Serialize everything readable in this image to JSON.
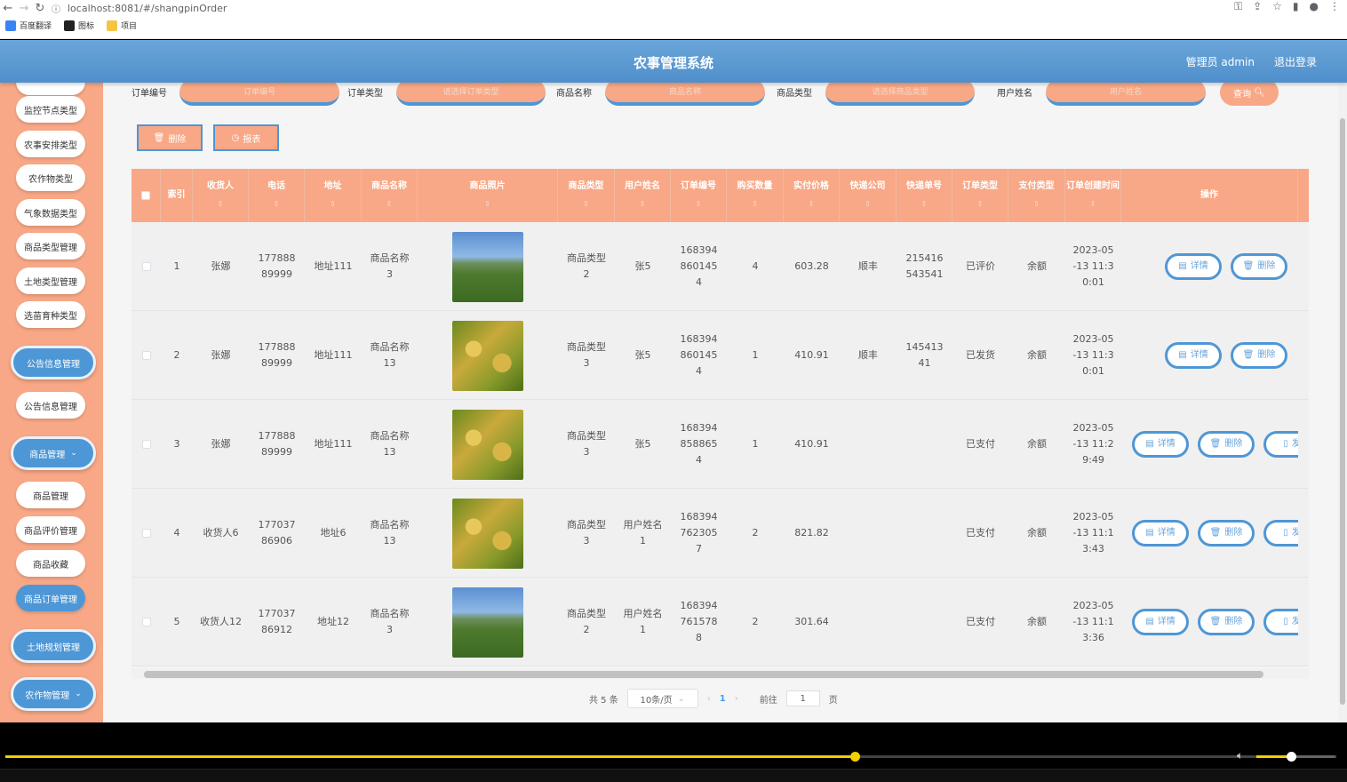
{
  "browser": {
    "url": "localhost:8081/#/shangpinOrder",
    "bookmarks": [
      "百度翻译",
      "图标",
      "项目"
    ]
  },
  "header": {
    "title": "农事管理系统",
    "admin": "管理员 admin",
    "logout": "退出登录"
  },
  "sidebar": {
    "items": [
      {
        "label": "监控节点类型",
        "type": "sub"
      },
      {
        "label": "农事安排类型",
        "type": "sub"
      },
      {
        "label": "农作物类型",
        "type": "sub"
      },
      {
        "label": "气象数据类型",
        "type": "sub"
      },
      {
        "label": "商品类型管理",
        "type": "sub"
      },
      {
        "label": "土地类型管理",
        "type": "sub"
      },
      {
        "label": "选苗育种类型",
        "type": "sub"
      },
      {
        "label": "公告信息管理",
        "type": "group"
      },
      {
        "label": "公告信息管理",
        "type": "sub"
      },
      {
        "label": "商品管理",
        "type": "group"
      },
      {
        "label": "商品管理",
        "type": "sub"
      },
      {
        "label": "商品评价管理",
        "type": "sub"
      },
      {
        "label": "商品收藏",
        "type": "sub"
      },
      {
        "label": "商品订单管理",
        "type": "active"
      },
      {
        "label": "土地规划管理",
        "type": "group"
      },
      {
        "label": "农作物管理",
        "type": "group"
      }
    ]
  },
  "search": {
    "fields": [
      {
        "label": "订单编号",
        "placeholder": "订单编号"
      },
      {
        "label": "订单类型",
        "placeholder": "请选择订单类型"
      },
      {
        "label": "商品名称",
        "placeholder": "商品名称"
      },
      {
        "label": "商品类型",
        "placeholder": "请选择商品类型"
      },
      {
        "label": "用户姓名",
        "placeholder": "用户姓名"
      }
    ],
    "button": "查询"
  },
  "toolbar": {
    "delete": "删除",
    "report": "报表"
  },
  "table": {
    "headers": [
      "索引",
      "收货人",
      "电话",
      "地址",
      "商品名称",
      "商品照片",
      "商品类型",
      "用户姓名",
      "订单编号",
      "购买数量",
      "实付价格",
      "快递公司",
      "快递单号",
      "订单类型",
      "支付类型",
      "订单创建时间",
      "操作"
    ],
    "actions": {
      "detail": "详情",
      "delete": "删除",
      "ship": "发"
    },
    "rows": [
      {
        "index": "1",
        "receiver": "张娜",
        "phone": "17788889999",
        "address": "地址111",
        "product": "商品名称3",
        "image": "field",
        "ptype": "商品类型2",
        "user": "张5",
        "order_no": "1683948601454",
        "qty": "4",
        "price": "603.28",
        "courier": "顺丰",
        "tracking": "215416543541",
        "otype": "已评价",
        "pay": "余额",
        "created": "2023-05-13 11:30:01"
      },
      {
        "index": "2",
        "receiver": "张娜",
        "phone": "17788889999",
        "address": "地址111",
        "product": "商品名称13",
        "image": "rice",
        "ptype": "商品类型3",
        "user": "张5",
        "order_no": "1683948601454",
        "qty": "1",
        "price": "410.91",
        "courier": "顺丰",
        "tracking": "14541341",
        "otype": "已发货",
        "pay": "余额",
        "created": "2023-05-13 11:30:01"
      },
      {
        "index": "3",
        "receiver": "张娜",
        "phone": "17788889999",
        "address": "地址111",
        "product": "商品名称13",
        "image": "rice",
        "ptype": "商品类型3",
        "user": "张5",
        "order_no": "1683948588654",
        "qty": "1",
        "price": "410.91",
        "courier": "",
        "tracking": "",
        "otype": "已支付",
        "pay": "余额",
        "created": "2023-05-13 11:29:49"
      },
      {
        "index": "4",
        "receiver": "收货人6",
        "phone": "17703786906",
        "address": "地址6",
        "product": "商品名称13",
        "image": "rice",
        "ptype": "商品类型3",
        "user": "用户姓名1",
        "order_no": "1683947623057",
        "qty": "2",
        "price": "821.82",
        "courier": "",
        "tracking": "",
        "otype": "已支付",
        "pay": "余额",
        "created": "2023-05-13 11:13:43"
      },
      {
        "index": "5",
        "receiver": "收货人12",
        "phone": "17703786912",
        "address": "地址12",
        "product": "商品名称3",
        "image": "field",
        "ptype": "商品类型2",
        "user": "用户姓名1",
        "order_no": "1683947615788",
        "qty": "2",
        "price": "301.64",
        "courier": "",
        "tracking": "",
        "otype": "已支付",
        "pay": "余额",
        "created": "2023-05-13 11:13:36"
      }
    ]
  },
  "pager": {
    "total": "共 5 条",
    "size": "10条/页",
    "current": "1",
    "goto": "前往",
    "goto_value": "1",
    "page_suffix": "页"
  },
  "player": {
    "progress": 0.638,
    "volume": 0.44
  },
  "colors": {
    "primary": "#4e97d6",
    "accent": "#f8a886"
  }
}
